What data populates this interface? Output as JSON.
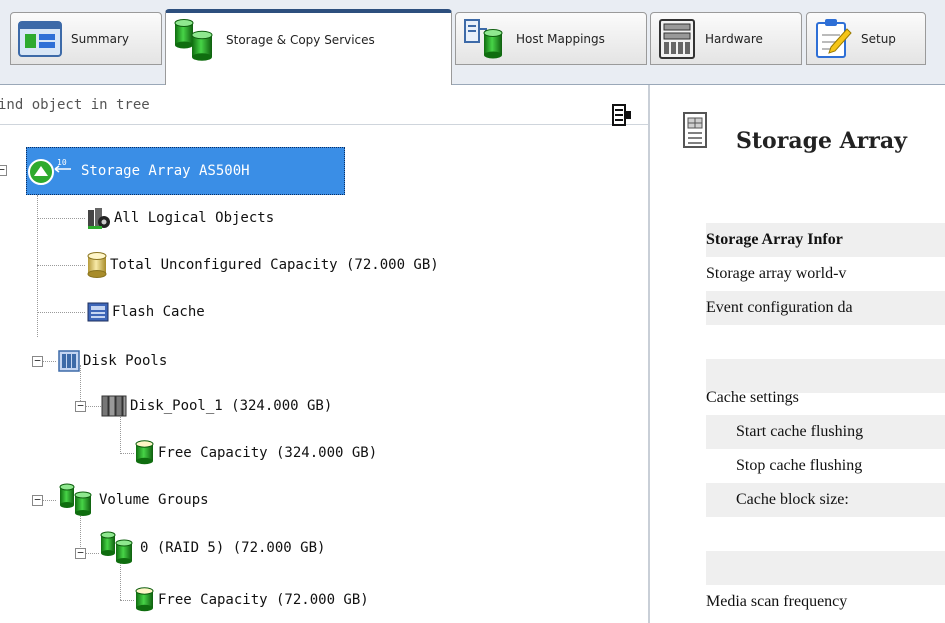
{
  "tabs": [
    {
      "label": "Summary",
      "icon": "summary-icon",
      "active": false
    },
    {
      "label": "Storage & Copy Services",
      "icon": "storage-cylinders-icon",
      "active": true
    },
    {
      "label": "Host Mappings",
      "icon": "host-mappings-icon",
      "active": false
    },
    {
      "label": "Hardware",
      "icon": "hardware-icon",
      "active": false
    },
    {
      "label": "Setup",
      "icon": "setup-clipboard-icon",
      "active": false
    }
  ],
  "tree": {
    "find_placeholder": "ind object in tree",
    "root": "Storage Array AS500H",
    "all_logical_objects": "All Logical Objects",
    "total_unconfigured": "Total Unconfigured Capacity (72.000 GB)",
    "flash_cache": "Flash Cache",
    "disk_pools": "Disk Pools",
    "disk_pool_1": "Disk_Pool_1 (324.000 GB)",
    "disk_pool_free": "Free Capacity (324.000 GB)",
    "volume_groups": "Volume Groups",
    "volume_group_0": "0 (RAID 5) (72.000 GB)",
    "volume_group_free": "Free Capacity (72.000 GB)"
  },
  "details": {
    "title": "Storage Array",
    "info_heading": "Storage Array Infor",
    "world_wide": "Storage array world-v",
    "event_config": "Event configuration da",
    "cache_settings": "Cache settings",
    "start_flush": "Start cache flushing",
    "stop_flush": "Stop cache flushing",
    "block_size": "Cache block size:",
    "media_scan": "Media scan frequency"
  },
  "colors": {
    "selection": "#3a8ee6",
    "active_tab_accent": "#2d4f7e",
    "cylinder_green": "#2eaa2e"
  }
}
